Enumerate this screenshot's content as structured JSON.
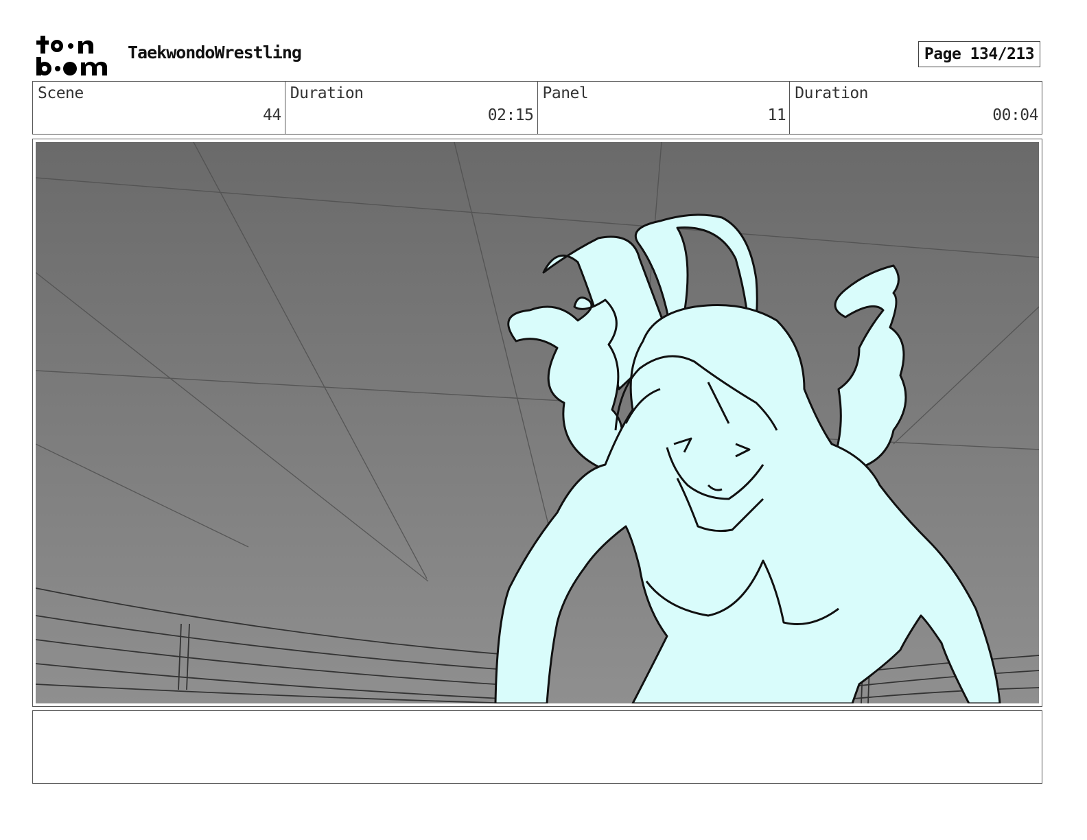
{
  "header": {
    "logo_name": "toon boom",
    "project_title": "TaekwondoWrestling",
    "page_label": "Page 134/213"
  },
  "info": [
    {
      "label": "Scene",
      "value": "44"
    },
    {
      "label": "Duration",
      "value": "02:15"
    },
    {
      "label": "Panel",
      "value": "11"
    },
    {
      "label": "Duration",
      "value": "00:04"
    }
  ],
  "panel": {
    "figure_fill": "#d9fcfb",
    "sky_top": "#6a6a6a",
    "sky_bottom": "#8f8f8f"
  },
  "notes": {
    "text": ""
  }
}
